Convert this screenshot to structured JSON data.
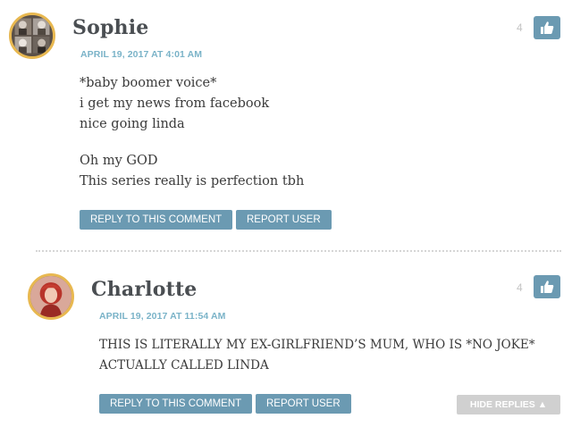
{
  "comments": [
    {
      "author": "Sophie",
      "date": "APRIL 19, 2017 AT 4:01 AM",
      "lines_a": [
        "*baby boomer voice*",
        "i get my news from facebook",
        "nice going linda"
      ],
      "lines_b": [
        "Oh my GOD",
        "This series really is perfection tbh"
      ],
      "votes": "4",
      "reply_label": "REPLY TO THIS COMMENT",
      "report_label": "REPORT USER"
    },
    {
      "author": "Charlotte",
      "date": "APRIL 19, 2017 AT 11:54 AM",
      "lines_a": [
        "THIS IS LITERALLY MY EX-GIRLFRIEND’S MUM, WHO IS *NO JOKE*",
        "ACTUALLY CALLED LINDA"
      ],
      "votes": "4",
      "reply_label": "REPLY TO THIS COMMENT",
      "report_label": "REPORT USER",
      "hide_replies_label": "HIDE REPLIES ▲"
    }
  ],
  "colors": {
    "accent": "#6b9ab2",
    "date": "#7ab3c8",
    "avatar_ring": "#e8b850",
    "hide_button": "#d0d0d0"
  },
  "icons": {
    "like": "thumbs-up-icon"
  }
}
